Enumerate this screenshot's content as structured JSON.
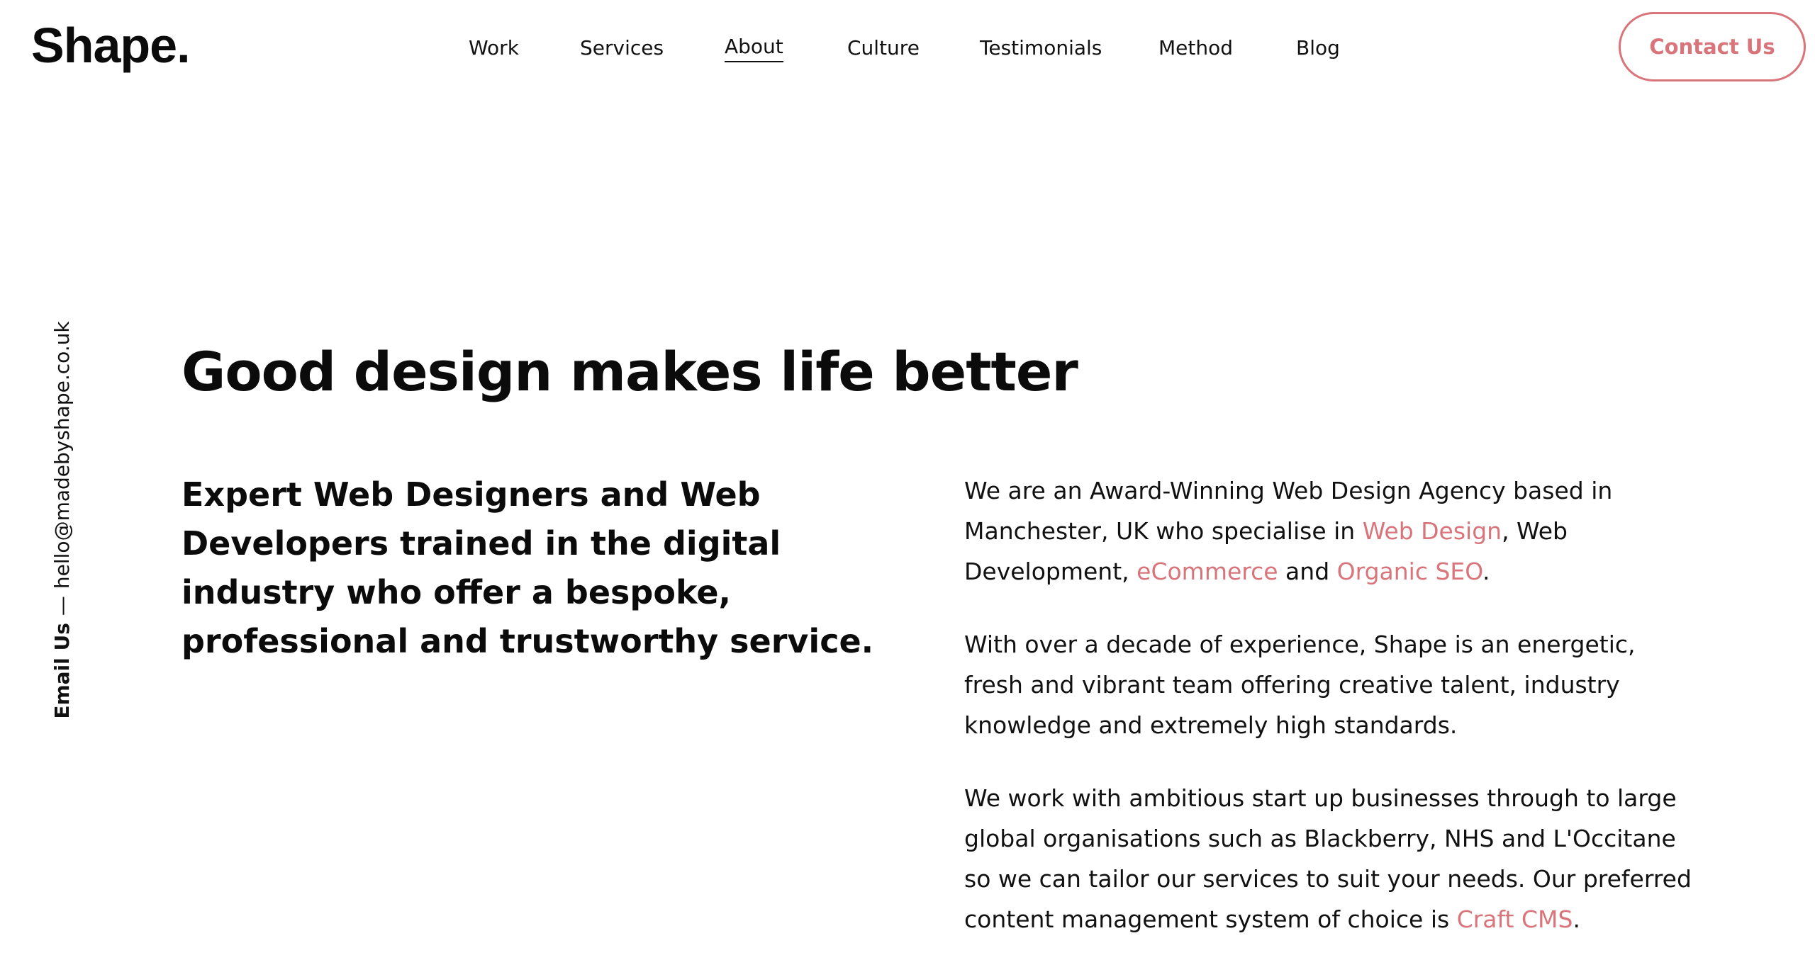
{
  "header": {
    "logo": "Shape.",
    "nav": [
      {
        "label": "Work",
        "active": false
      },
      {
        "label": "Services",
        "active": false
      },
      {
        "label": "About",
        "active": true
      },
      {
        "label": "Culture",
        "active": false
      },
      {
        "label": "Testimonials",
        "active": false
      },
      {
        "label": "Method",
        "active": false
      },
      {
        "label": "Blog",
        "active": false
      }
    ],
    "contact_button": "Contact Us"
  },
  "side": {
    "email_label": "Email Us",
    "separator": "—",
    "email": "hello@madebyshape.co.uk"
  },
  "main": {
    "headline": "Good design makes life better",
    "subhead": "Expert Web Designers and Web Developers trained in the digital industry who offer a bespoke, professional and trustworthy service.",
    "p1": {
      "t1": "We are an Award-Winning Web Design Agency based in Manchester, UK who specialise in ",
      "link1": "Web Design",
      "t2": ", Web Development, ",
      "link2": "eCommerce",
      "t3": " and ",
      "link3": "Organic SEO",
      "t4": "."
    },
    "p2": "With over a decade of experience, Shape is an energetic, fresh and vibrant team offering creative talent, industry knowledge and extremely high standards.",
    "p3": {
      "t1": "We work with ambitious start up businesses through to large global organisations such as Blackberry, NHS and L'Occitane so we can tailor our services to suit your needs. Our preferred content management system of choice is ",
      "link1": "Craft CMS",
      "t2": "."
    }
  },
  "colors": {
    "accent": "#d9757a",
    "text": "#111111",
    "background": "#ffffff"
  }
}
